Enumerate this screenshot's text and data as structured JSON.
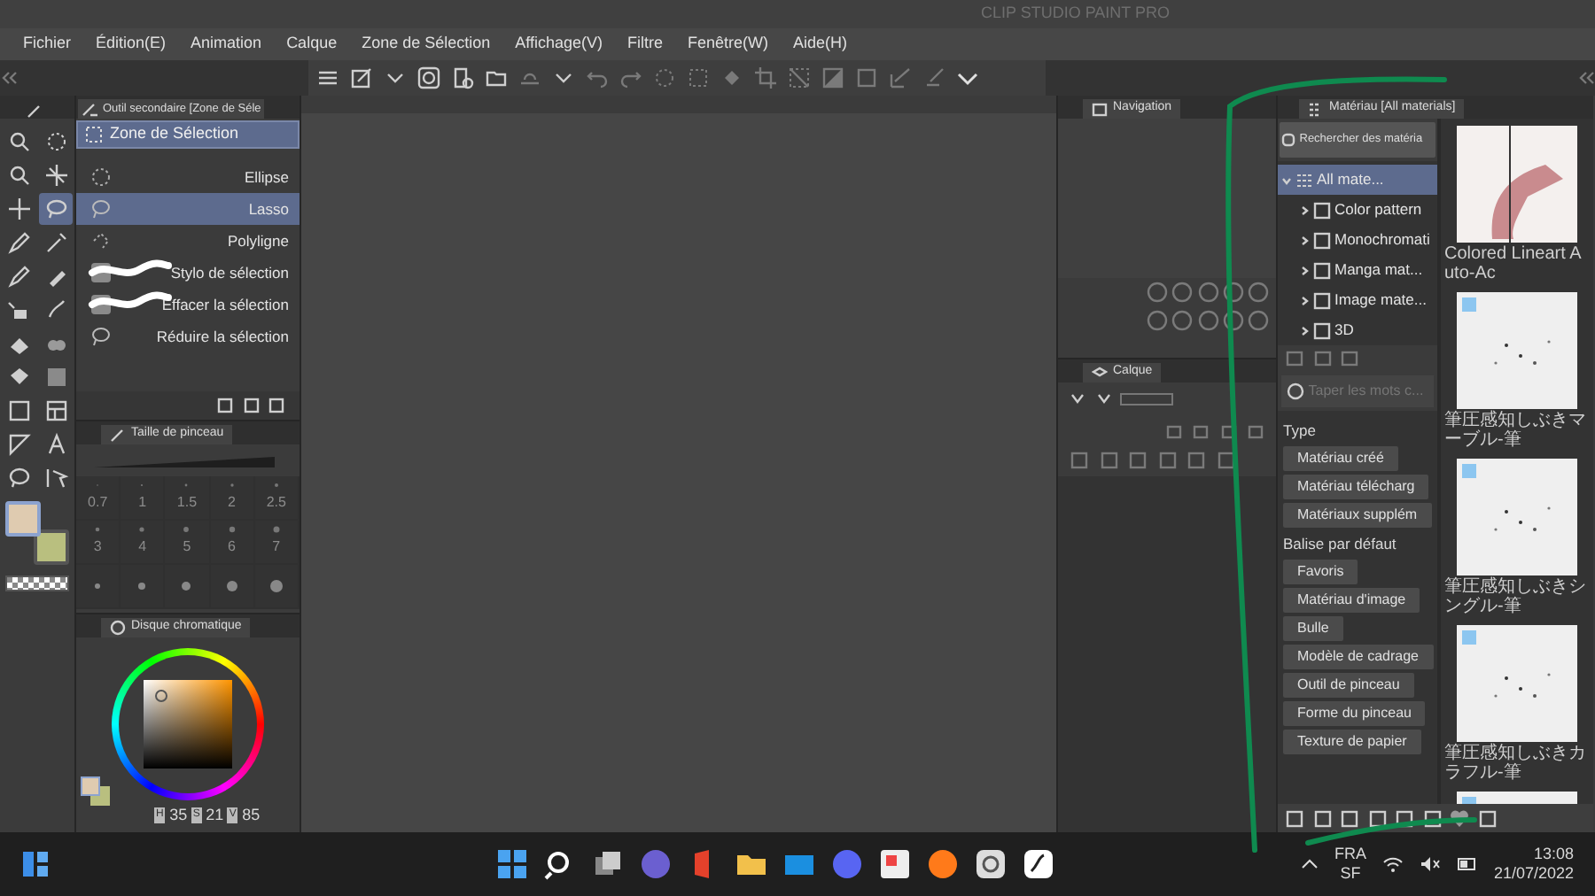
{
  "window": {
    "title": "CLIP STUDIO PAINT PRO"
  },
  "menu": [
    "Fichier",
    "Édition(E)",
    "Animation",
    "Calque",
    "Zone de Sélection",
    "Affichage(V)",
    "Filtre",
    "Fenêtre(W)",
    "Aide(H)"
  ],
  "tool_palette": {
    "tools": [
      {
        "selected": false
      },
      {
        "selected": false
      },
      {
        "selected": false
      },
      {
        "selected": false
      },
      {
        "selected": false
      },
      {
        "selected": true
      },
      {
        "selected": false
      },
      {
        "selected": false
      },
      {
        "selected": false
      },
      {
        "selected": false
      },
      {
        "selected": false
      },
      {
        "selected": false
      },
      {
        "selected": false
      },
      {
        "selected": false
      },
      {
        "selected": false
      },
      {
        "selected": false
      },
      {
        "selected": false
      },
      {
        "selected": false
      },
      {
        "selected": false
      },
      {
        "selected": false
      },
      {
        "selected": false
      },
      {
        "selected": false
      }
    ],
    "swatches": [
      {
        "color": "#dfcbb0",
        "selected": true
      },
      {
        "color": "#b9bf7f",
        "selected": false
      }
    ]
  },
  "sub_tool": {
    "tab": "Outil secondaire [Zone de Séle",
    "group": "Zone de Sélection",
    "items": [
      {
        "label": "Ellipse",
        "selected": false
      },
      {
        "label": "Lasso",
        "selected": true
      },
      {
        "label": "Polyligne",
        "selected": false
      },
      {
        "label": "Stylo de sélection",
        "selected": false
      },
      {
        "label": "Effacer la sélection",
        "selected": false
      },
      {
        "label": "Réduire la sélection",
        "selected": false
      }
    ]
  },
  "brush_size": {
    "tab": "Taille de pinceau",
    "sizes": [
      "0.7",
      "1",
      "1.5",
      "2",
      "2.5",
      "3",
      "4",
      "5",
      "6",
      "7"
    ]
  },
  "color_wheel": {
    "tab": "Disque chromatique",
    "values": [
      {
        "label": "H",
        "value": "35"
      },
      {
        "label": "S",
        "value": "21"
      },
      {
        "label": "V",
        "value": "85"
      }
    ]
  },
  "navigation": {
    "tab": "Navigation"
  },
  "layer": {
    "tab": "Calque"
  },
  "materials": {
    "tab": "Matériau [All materials]",
    "search_button": "Rechercher des matéria",
    "tree": [
      {
        "label": "All mate...",
        "expanded": true,
        "selected": true,
        "children": [
          {
            "label": "Color pattern",
            "expanded": false,
            "selected": false
          },
          {
            "label": "Monochromati",
            "expanded": false,
            "selected": false
          },
          {
            "label": "Manga mat...",
            "expanded": false,
            "selected": false
          },
          {
            "label": "Image mate...",
            "expanded": false,
            "selected": false
          },
          {
            "label": "3D",
            "expanded": false,
            "selected": false
          }
        ]
      }
    ],
    "search": {
      "placeholder": "Taper les mots c..."
    },
    "sections": [
      {
        "heading": "Type",
        "tags": [
          "Matériau créé",
          "Matériau télécharg",
          "Matériaux supplém"
        ]
      },
      {
        "heading": "Balise par défaut",
        "tags": [
          "Favoris",
          "Matériau d'image",
          "Bulle",
          "Modèle de cadrage",
          "Outil de pinceau",
          "Forme du pinceau",
          "Texture de papier"
        ]
      }
    ],
    "thumbnails": [
      {
        "caption": "Colored Lineart Auto-Ac",
        "kind": "drawing"
      },
      {
        "caption": "筆圧感知しぶきマーブル-筆",
        "kind": "splatter"
      },
      {
        "caption": "筆圧感知しぶきシングル-筆",
        "kind": "splatter"
      },
      {
        "caption": "筆圧感知しぶきカラフル-筆",
        "kind": "splatter"
      },
      {
        "kind": "splatter"
      }
    ]
  },
  "taskbar": {
    "language": "FRA",
    "layout": "SF",
    "time": "13:08",
    "date": "21/07/2022"
  }
}
